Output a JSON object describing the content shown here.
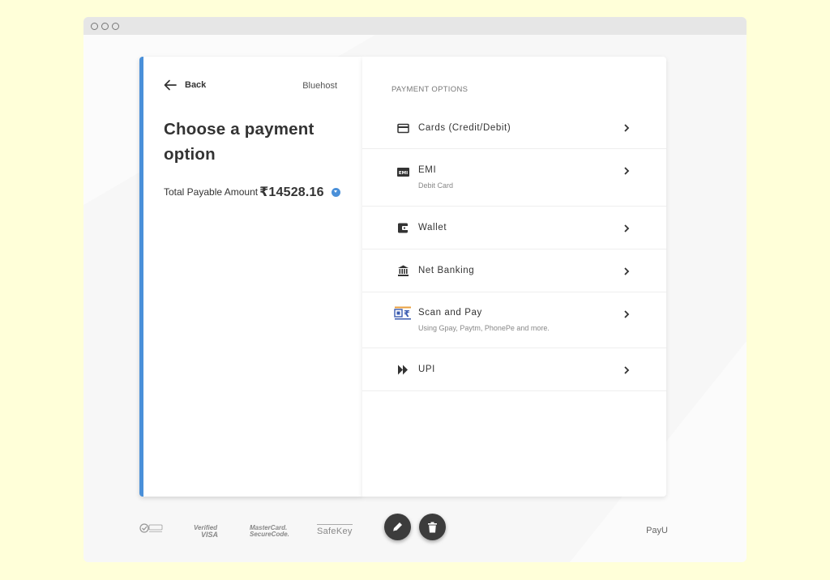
{
  "header": {
    "back_label": "Back",
    "merchant": "Bluehost",
    "title": "Choose a payment option",
    "amount_label": "Total Payable Amount",
    "amount_value": "₹14528.16"
  },
  "payment_options": {
    "heading": "PAYMENT OPTIONS",
    "items": [
      {
        "label": "Cards (Credit/Debit)",
        "sub": "",
        "icon": "card-icon"
      },
      {
        "label": "EMI",
        "sub": "Debit Card",
        "icon": "emi-icon"
      },
      {
        "label": "Wallet",
        "sub": "",
        "icon": "wallet-icon"
      },
      {
        "label": "Net Banking",
        "sub": "",
        "icon": "bank-icon"
      },
      {
        "label": "Scan and Pay",
        "sub": "Using Gpay, Paytm, PhonePe and more.",
        "icon": "qr-rupee-icon"
      },
      {
        "label": "UPI",
        "sub": "",
        "icon": "upi-icon"
      }
    ]
  },
  "footer": {
    "logos": [
      "PCI DSS",
      "Verified by VISA",
      "MasterCard SecureCode",
      "SafeKey",
      "PayU"
    ],
    "visa_line1": "Verified",
    "visa_line2": "VISA",
    "mc_line1": "MasterCard.",
    "mc_line2": "SecureCode.",
    "safekey": "SafeKey",
    "payu": "PayU"
  },
  "colors": {
    "accent": "#4a90d9",
    "page_background": "#ffffd9",
    "fab": "#3c3c3c"
  }
}
